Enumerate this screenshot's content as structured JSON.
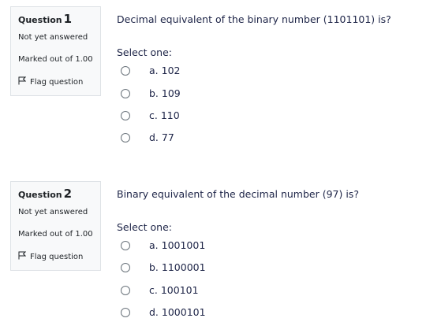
{
  "questions": [
    {
      "label": "Question",
      "number": "1",
      "state": "Not yet answered",
      "grade": "Marked out of 1.00",
      "flag_label": "Flag question",
      "text": "Decimal equivalent of the binary number (1101101) is?",
      "prompt": "Select one:",
      "options": [
        {
          "letter": "a.",
          "value": "102"
        },
        {
          "letter": "b.",
          "value": "109"
        },
        {
          "letter": "c.",
          "value": "110"
        },
        {
          "letter": "d.",
          "value": "77"
        }
      ]
    },
    {
      "label": "Question",
      "number": "2",
      "state": "Not yet answered",
      "grade": "Marked out of 1.00",
      "flag_label": "Flag question",
      "text": "Binary equivalent of the decimal number (97) is?",
      "prompt": "Select one:",
      "options": [
        {
          "letter": "a.",
          "value": "1001001"
        },
        {
          "letter": "b.",
          "value": "1100001"
        },
        {
          "letter": "c.",
          "value": "100101"
        },
        {
          "letter": "d.",
          "value": "1000101"
        }
      ]
    }
  ]
}
